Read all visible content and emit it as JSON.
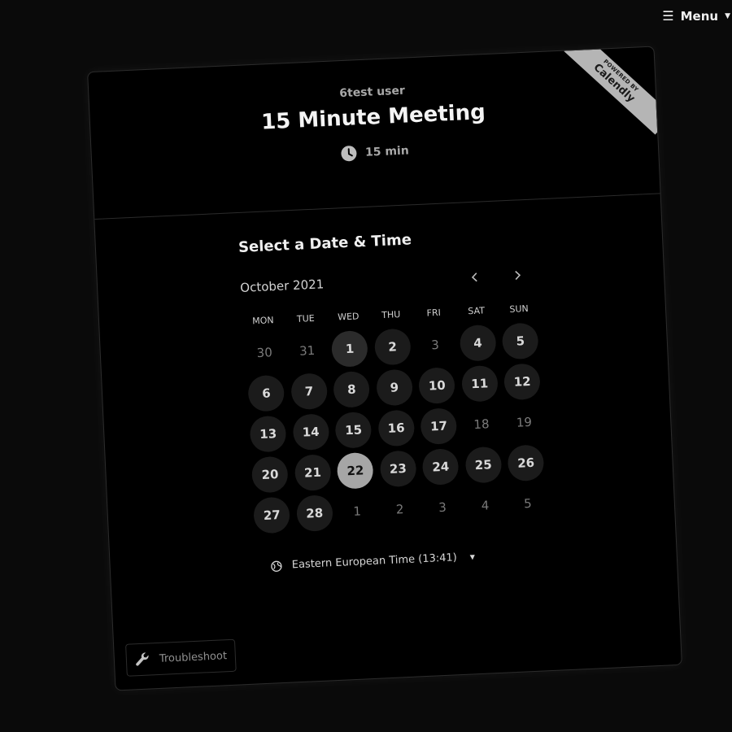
{
  "topnav": {
    "menu_label": "Menu"
  },
  "ribbon": {
    "powered_by": "POWERED BY",
    "brand": "Calendly"
  },
  "event": {
    "organizer": "6test user",
    "title": "15 Minute Meeting",
    "duration": "15 min"
  },
  "calendar": {
    "section_title": "Select a Date & Time",
    "month_label": "October 2021",
    "weekdays": [
      "MON",
      "TUE",
      "WED",
      "THU",
      "FRI",
      "SAT",
      "SUN"
    ],
    "days": [
      {
        "label": "30",
        "state": "muted"
      },
      {
        "label": "31",
        "state": "muted"
      },
      {
        "label": "1",
        "state": "today"
      },
      {
        "label": "2",
        "state": "available"
      },
      {
        "label": "3",
        "state": "muted"
      },
      {
        "label": "4",
        "state": "available"
      },
      {
        "label": "5",
        "state": "available"
      },
      {
        "label": "6",
        "state": "available"
      },
      {
        "label": "7",
        "state": "available"
      },
      {
        "label": "8",
        "state": "available"
      },
      {
        "label": "9",
        "state": "available"
      },
      {
        "label": "10",
        "state": "available"
      },
      {
        "label": "11",
        "state": "available"
      },
      {
        "label": "12",
        "state": "available"
      },
      {
        "label": "13",
        "state": "available"
      },
      {
        "label": "14",
        "state": "available"
      },
      {
        "label": "15",
        "state": "available"
      },
      {
        "label": "16",
        "state": "available"
      },
      {
        "label": "17",
        "state": "available"
      },
      {
        "label": "18",
        "state": "muted"
      },
      {
        "label": "19",
        "state": "muted"
      },
      {
        "label": "20",
        "state": "available"
      },
      {
        "label": "21",
        "state": "available"
      },
      {
        "label": "22",
        "state": "selected"
      },
      {
        "label": "23",
        "state": "available"
      },
      {
        "label": "24",
        "state": "available"
      },
      {
        "label": "25",
        "state": "available"
      },
      {
        "label": "26",
        "state": "available"
      },
      {
        "label": "27",
        "state": "available"
      },
      {
        "label": "28",
        "state": "available"
      },
      {
        "label": "1",
        "state": "muted"
      },
      {
        "label": "2",
        "state": "muted"
      },
      {
        "label": "3",
        "state": "muted"
      },
      {
        "label": "4",
        "state": "muted"
      },
      {
        "label": "5",
        "state": "muted"
      }
    ]
  },
  "timezone": {
    "label": "Eastern European Time (13:41)"
  },
  "troubleshoot": {
    "label": "Troubleshoot"
  }
}
